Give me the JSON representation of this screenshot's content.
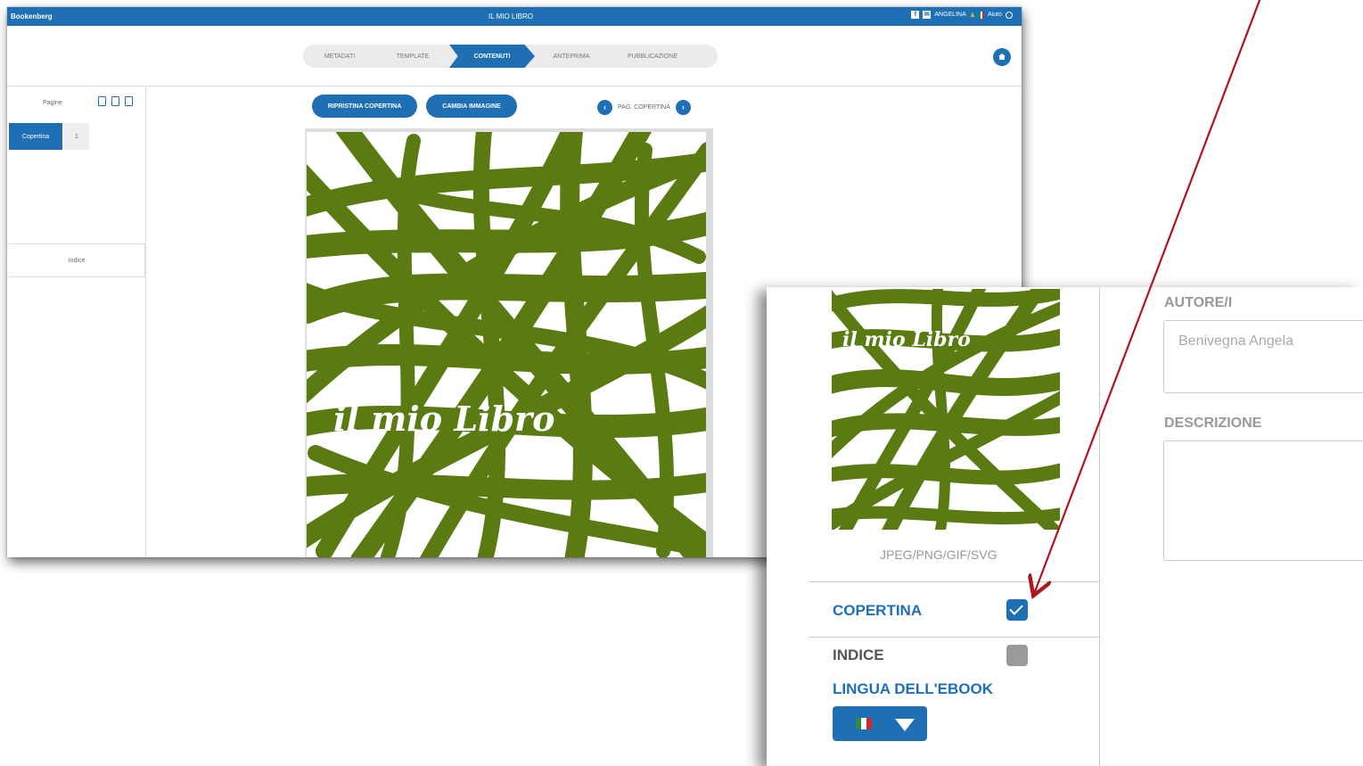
{
  "app": {
    "brand": "Bookenberg",
    "title": "IL MIO LIBRO",
    "user": "ANGELINA",
    "help": "Aiuto"
  },
  "steps": [
    "METADATI",
    "TEMPLATE",
    "CONTENUTI",
    "ANTEPRIMA",
    "PUBBLICAZIONE"
  ],
  "active_step": "CONTENUTI",
  "sidebar": {
    "pages_label": "Pagine",
    "tabs": [
      "Copertina",
      "1"
    ],
    "indice": "Indice"
  },
  "toolbar": {
    "restore_cover": "RIPRISTINA COPERTINA",
    "change_image": "CAMBIA IMMAGINE",
    "page_nav_label": "PAG. COPERTINA"
  },
  "cover": {
    "title": "il mio Libro",
    "color": "#5a7a12"
  },
  "zoom_panel": {
    "cover_title": "il mio Libro",
    "formats": "JPEG/PNG/GIF/SVG",
    "copertina_label": "COPERTINA",
    "copertina_checked": true,
    "indice_label": "INDICE",
    "indice_checked": false,
    "language_label": "LINGUA DELL'EBOOK",
    "author_label": "AUTORE/I",
    "author_value": "Benivegna Angela",
    "description_label": "DESCRIZIONE"
  },
  "colors": {
    "accent": "#1f6fb5",
    "arrow": "#b0141c"
  }
}
